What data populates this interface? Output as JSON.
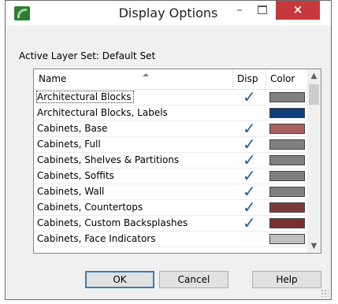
{
  "window": {
    "title": "Display Options",
    "minimize_label": "–",
    "close_label": "×"
  },
  "active_layer": {
    "label": "Active Layer Set:",
    "value": "Default Set"
  },
  "list": {
    "columns": [
      "Name",
      "Disp",
      "Color"
    ],
    "rows": [
      {
        "name": "Architectural Blocks",
        "disp": true,
        "color": "#808080",
        "focused": true
      },
      {
        "name": "Architectural Blocks, Labels",
        "disp": false,
        "color": "#0d3e7a"
      },
      {
        "name": "Cabinets,  Base",
        "disp": true,
        "color": "#a86060"
      },
      {
        "name": "Cabinets,  Full",
        "disp": true,
        "color": "#808080"
      },
      {
        "name": "Cabinets,  Shelves & Partitions",
        "disp": true,
        "color": "#808080"
      },
      {
        "name": "Cabinets,  Soffits",
        "disp": true,
        "color": "#808080"
      },
      {
        "name": "Cabinets,  Wall",
        "disp": true,
        "color": "#808080"
      },
      {
        "name": "Cabinets, Countertops",
        "disp": true,
        "color": "#7a3a3a"
      },
      {
        "name": "Cabinets, Custom Backsplashes",
        "disp": true,
        "color": "#7a3030"
      },
      {
        "name": "Cabinets, Face Indicators",
        "disp": false,
        "color": "#c0c0c0"
      }
    ],
    "check_glyph": "✓"
  },
  "buttons": {
    "ok": "OK",
    "cancel": "Cancel",
    "help": "Help"
  }
}
